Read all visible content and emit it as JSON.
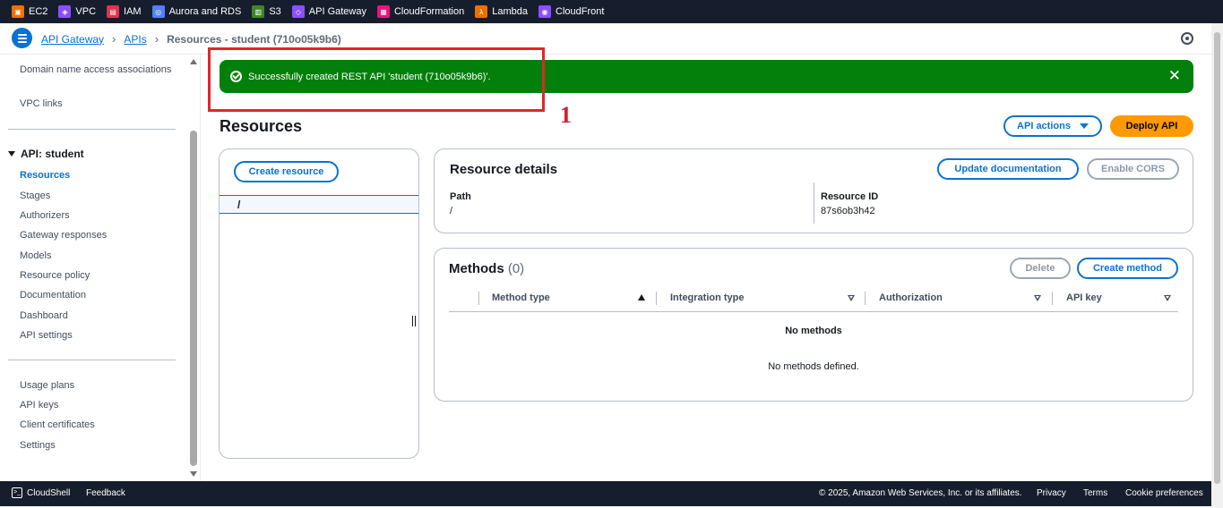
{
  "favorites": [
    {
      "label": "EC2",
      "icon": "ec2-icon",
      "color": "#ed7100"
    },
    {
      "label": "VPC",
      "icon": "vpc-icon",
      "color": "#8c4fff"
    },
    {
      "label": "IAM",
      "icon": "iam-icon",
      "color": "#dd344c"
    },
    {
      "label": "Aurora and RDS",
      "icon": "rds-icon",
      "color": "#527fff"
    },
    {
      "label": "S3",
      "icon": "s3-icon",
      "color": "#3f8624"
    },
    {
      "label": "API Gateway",
      "icon": "api-gateway-icon",
      "color": "#8c4fff"
    },
    {
      "label": "CloudFormation",
      "icon": "cloudformation-icon",
      "color": "#e7157b"
    },
    {
      "label": "Lambda",
      "icon": "lambda-icon",
      "color": "#ed7100"
    },
    {
      "label": "CloudFront",
      "icon": "cloudfront-icon",
      "color": "#8c4fff"
    }
  ],
  "breadcrumb": {
    "items": [
      "API Gateway",
      "APIs"
    ],
    "current": "Resources - student (710o05k9b6)"
  },
  "sidebar": {
    "top_items": [
      "Domain name access associations",
      "VPC links"
    ],
    "api_heading": "API: student",
    "api_items": [
      "Resources",
      "Stages",
      "Authorizers",
      "Gateway responses",
      "Models",
      "Resource policy",
      "Documentation",
      "Dashboard",
      "API settings"
    ],
    "bottom_items": [
      "Usage plans",
      "API keys",
      "Client certificates",
      "Settings"
    ]
  },
  "flash": {
    "message": "Successfully created REST API 'student (710o05k9b6)'.",
    "close": "✕",
    "color": "#037f0c"
  },
  "annotation": {
    "label": "1",
    "color": "#e3242b"
  },
  "resources": {
    "title": "Resources",
    "api_actions": "API actions",
    "deploy": "Deploy API",
    "create_resource": "Create resource",
    "root_path": "/"
  },
  "details": {
    "title": "Resource details",
    "update_doc": "Update documentation",
    "enable_cors": "Enable CORS",
    "path_label": "Path",
    "path_value": "/",
    "id_label": "Resource ID",
    "id_value": "87s6ob3h42"
  },
  "methods": {
    "title": "Methods",
    "count": "(0)",
    "delete": "Delete",
    "create": "Create method",
    "columns": [
      "Method type",
      "Integration type",
      "Authorization",
      "API key"
    ],
    "empty_title": "No methods",
    "empty_desc": "No methods defined."
  },
  "footer": {
    "cloudshell": "CloudShell",
    "feedback": "Feedback",
    "copyright": "© 2025, Amazon Web Services, Inc. or its affiliates.",
    "privacy": "Privacy",
    "terms": "Terms",
    "cookies": "Cookie preferences"
  }
}
